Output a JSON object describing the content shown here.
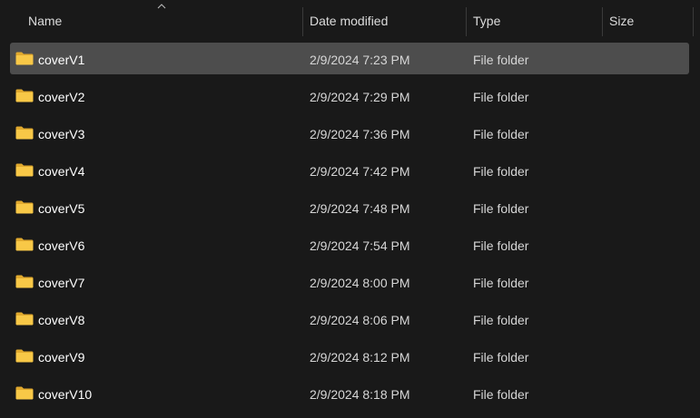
{
  "columns": {
    "name": "Name",
    "date_modified": "Date modified",
    "type": "Type",
    "size": "Size"
  },
  "sort": {
    "column": "name",
    "icon": "chevron-up-icon"
  },
  "colors": {
    "background": "#191919",
    "selected_row": "#4d4d4d",
    "folder_yellow": "#f8c847"
  },
  "files": [
    {
      "name": "coverV1",
      "date": "2/9/2024 7:23 PM",
      "type": "File folder",
      "size": "",
      "selected": true
    },
    {
      "name": "coverV2",
      "date": "2/9/2024 7:29 PM",
      "type": "File folder",
      "size": ""
    },
    {
      "name": "coverV3",
      "date": "2/9/2024 7:36 PM",
      "type": "File folder",
      "size": ""
    },
    {
      "name": "coverV4",
      "date": "2/9/2024 7:42 PM",
      "type": "File folder",
      "size": ""
    },
    {
      "name": "coverV5",
      "date": "2/9/2024 7:48 PM",
      "type": "File folder",
      "size": ""
    },
    {
      "name": "coverV6",
      "date": "2/9/2024 7:54 PM",
      "type": "File folder",
      "size": ""
    },
    {
      "name": "coverV7",
      "date": "2/9/2024 8:00 PM",
      "type": "File folder",
      "size": ""
    },
    {
      "name": "coverV8",
      "date": "2/9/2024 8:06 PM",
      "type": "File folder",
      "size": ""
    },
    {
      "name": "coverV9",
      "date": "2/9/2024 8:12 PM",
      "type": "File folder",
      "size": ""
    },
    {
      "name": "coverV10",
      "date": "2/9/2024 8:18 PM",
      "type": "File folder",
      "size": ""
    }
  ]
}
